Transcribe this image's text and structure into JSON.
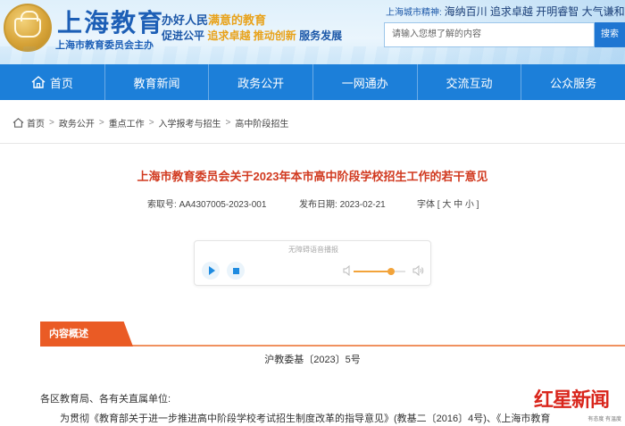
{
  "header": {
    "logo_title": "上海教育",
    "logo_subtitle": "上海市教育委员会主办",
    "slogan_line1_a": "办好人民",
    "slogan_line1_b": "满意的教育",
    "slogan_line2_a": "促进公平",
    "slogan_line2_b": "追求卓越",
    "slogan_line2_c": "推动创新",
    "slogan_line2_d": "服务发展",
    "city_spirit_label": "上海城市精神:",
    "city_spirit_value": "海纳百川 追求卓越 开明睿智 大气谦和",
    "search_placeholder": "请输入您想了解的内容",
    "search_button": "搜索"
  },
  "nav": {
    "items": [
      {
        "label": "首页"
      },
      {
        "label": "教育新闻"
      },
      {
        "label": "政务公开"
      },
      {
        "label": "一网通办"
      },
      {
        "label": "交流互动"
      },
      {
        "label": "公众服务"
      }
    ]
  },
  "breadcrumb": {
    "items": [
      "首页",
      "政务公开",
      "重点工作",
      "入学报考与招生",
      "高中阶段招生"
    ],
    "separator": ">"
  },
  "article": {
    "title": "上海市教育委员会关于2023年本市高中阶段学校招生工作的若干意见",
    "index_label": "索取号:",
    "index_value": "AA4307005-2023-001",
    "date_label": "发布日期:",
    "date_value": "2023-02-21",
    "font_label": "字体",
    "font_sizes": "[ 大 中 小 ]"
  },
  "player": {
    "caption": "无障碍语音播报",
    "volume_fraction": 0.72
  },
  "summary": {
    "tag": "内容概述",
    "doc_number": "沪教委基〔2023〕5号",
    "addressee": "各区教育局、各有关直属单位:",
    "body_first_line": "为贯彻《教育部关于进一步推进高中阶段学校考试招生制度改革的指导意见》(教基二〔2016〕4号)、《上海市教育"
  },
  "watermark": {
    "brand": "红星新闻",
    "sub": "有态度 有温度"
  },
  "colors": {
    "nav_bg": "#1c7fd9",
    "title_red": "#d13a20",
    "tag_orange": "#ea5b25",
    "brand_blue": "#1d5fb6"
  }
}
